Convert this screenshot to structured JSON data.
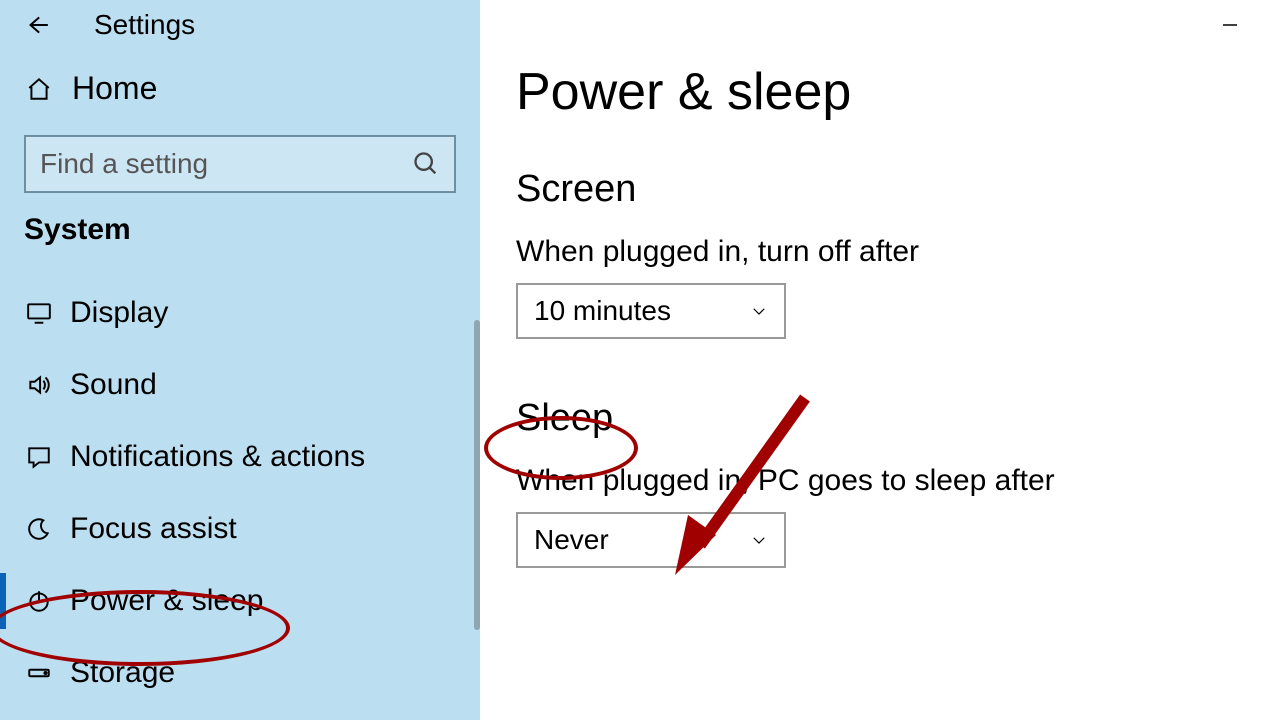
{
  "header": {
    "title": "Settings"
  },
  "sidebar": {
    "home": "Home",
    "search_placeholder": "Find a setting",
    "section": "System",
    "items": [
      {
        "label": "Display"
      },
      {
        "label": "Sound"
      },
      {
        "label": "Notifications & actions"
      },
      {
        "label": "Focus assist"
      },
      {
        "label": "Power & sleep"
      },
      {
        "label": "Storage"
      }
    ]
  },
  "main": {
    "page_title": "Power & sleep",
    "screen": {
      "heading": "Screen",
      "label": "When plugged in, turn off after",
      "value": "10 minutes"
    },
    "sleep": {
      "heading": "Sleep",
      "label": "When plugged in, PC goes to sleep after",
      "value": "Never"
    }
  }
}
